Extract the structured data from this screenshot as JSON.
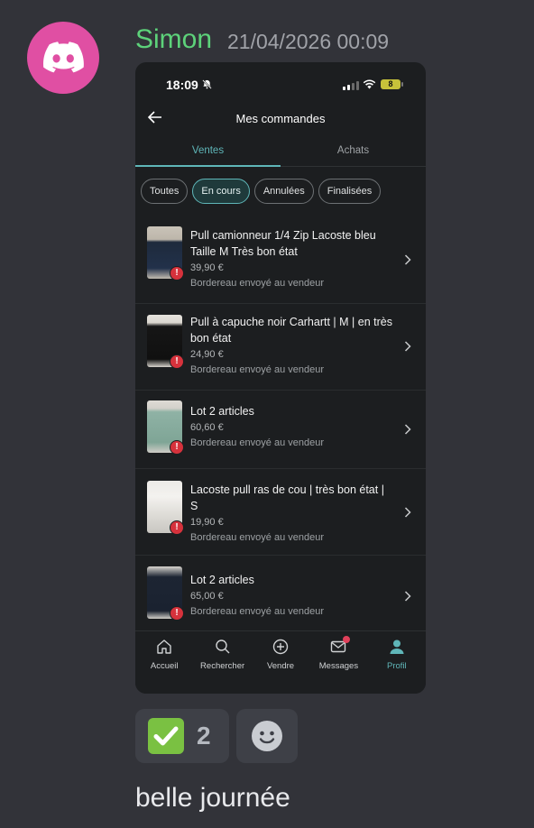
{
  "message": {
    "author": "Simon",
    "timestamp": "21/04/2026 00:09",
    "text": "belle journée",
    "avatar_icon": "discord-logo-icon",
    "avatar_color": "#e04fa3",
    "author_color": "#5dd27a"
  },
  "phone": {
    "status_bar": {
      "time": "18:09",
      "battery": "8"
    },
    "header": {
      "title": "Mes commandes"
    },
    "tabs": [
      {
        "label": "Ventes",
        "active": true
      },
      {
        "label": "Achats",
        "active": false
      }
    ],
    "filters": [
      {
        "label": "Toutes",
        "active": false
      },
      {
        "label": "En cours",
        "active": true
      },
      {
        "label": "Annulées",
        "active": false
      },
      {
        "label": "Finalisées",
        "active": false
      }
    ],
    "orders": [
      {
        "title": "Pull camionneur 1/4 Zip Lacoste bleu Taille M Très bon état",
        "price": "39,90 €",
        "status": "Bordereau envoyé au vendeur"
      },
      {
        "title": "Pull à capuche noir Carhartt | M | en très bon état",
        "price": "24,90 €",
        "status": "Bordereau envoyé au vendeur"
      },
      {
        "title": "Lot 2 articles",
        "price": "60,60 €",
        "status": "Bordereau envoyé au vendeur"
      },
      {
        "title": "Lacoste pull ras de cou | très bon état | S",
        "price": "19,90 €",
        "status": "Bordereau envoyé au vendeur"
      },
      {
        "title": "Lot 2 articles",
        "price": "65,00 €",
        "status": "Bordereau envoyé au vendeur"
      }
    ],
    "bottom_nav": [
      {
        "label": "Accueil",
        "icon": "home-icon"
      },
      {
        "label": "Rechercher",
        "icon": "search-icon"
      },
      {
        "label": "Vendre",
        "icon": "plus-circle-icon"
      },
      {
        "label": "Messages",
        "icon": "mail-icon"
      },
      {
        "label": "Profil",
        "icon": "profile-icon"
      }
    ],
    "accent_color": "#5fb6b8"
  },
  "reactions": [
    {
      "emoji": "white-check-mark-icon",
      "count": "2"
    }
  ]
}
